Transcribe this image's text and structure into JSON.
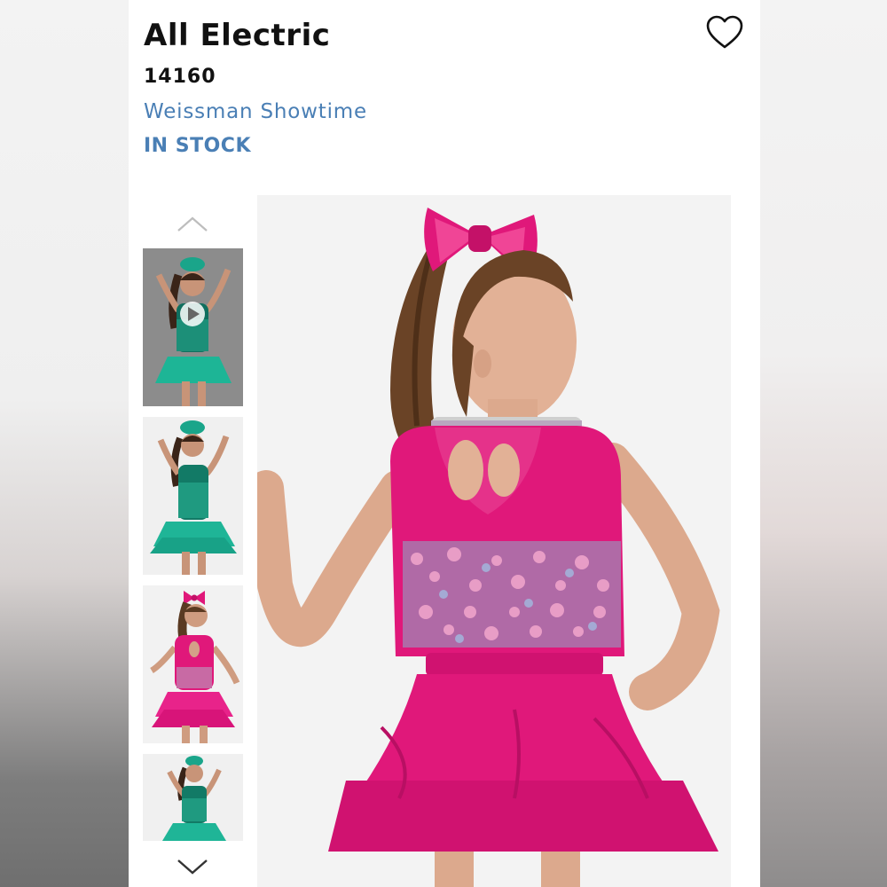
{
  "product": {
    "title": "All Electric",
    "sku": "14160",
    "brand": "Weissman Showtime",
    "stock_status": "IN STOCK"
  },
  "icons": {
    "favorite": "heart-outline-icon",
    "scroll_up": "chevron-up-icon",
    "scroll_down": "chevron-down-icon",
    "video": "play-icon"
  },
  "colors": {
    "brand_link": "#4a7fb5",
    "costume_pink": "#e0187a",
    "costume_teal": "#1aa58a"
  },
  "gallery": {
    "thumbnails": [
      {
        "alt": "teal costume front video",
        "variant": "teal",
        "has_video": true
      },
      {
        "alt": "teal costume front",
        "variant": "teal",
        "has_video": false
      },
      {
        "alt": "pink costume back",
        "variant": "pink",
        "has_video": false
      },
      {
        "alt": "teal costume front small",
        "variant": "teal",
        "has_video": false
      }
    ],
    "main_image": {
      "alt": "pink costume back view with bow",
      "variant": "pink"
    }
  }
}
